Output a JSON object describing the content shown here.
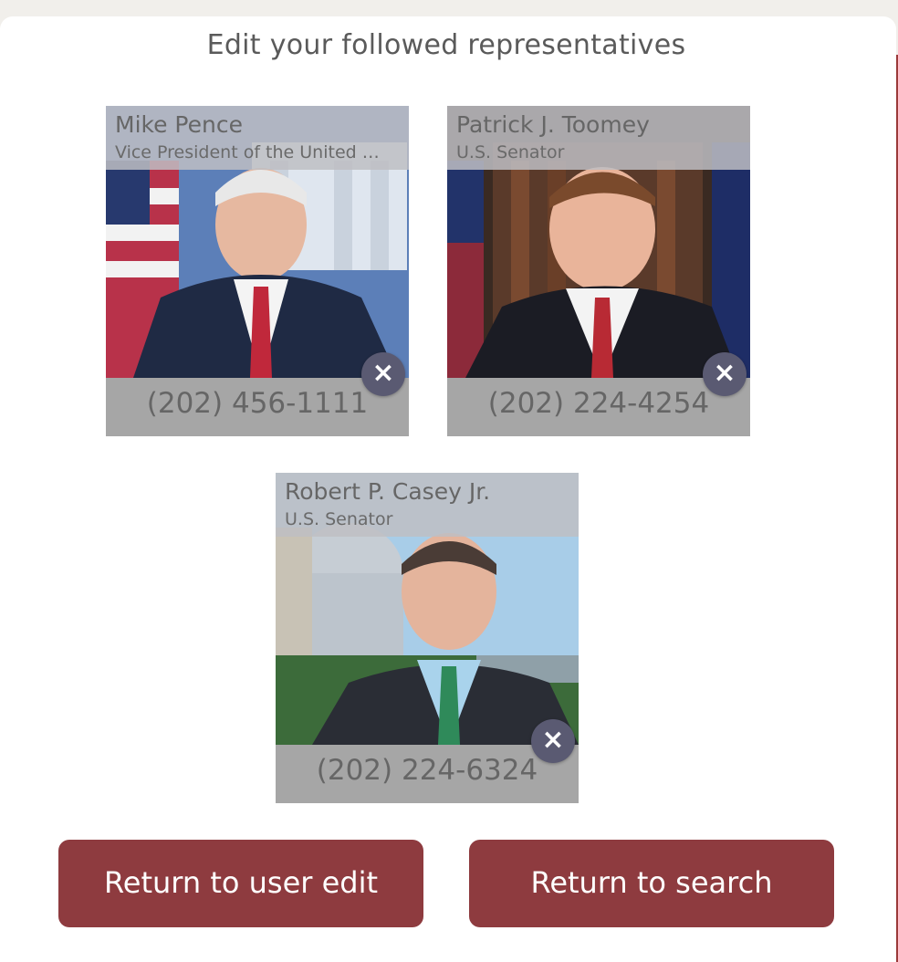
{
  "page": {
    "title": "Edit your followed representatives",
    "accent_color": "#8e3b3f"
  },
  "representatives": [
    {
      "name": "Mike Pence",
      "title": "Vice President of the United …",
      "phone": "(202) 456-1111",
      "remove_icon": "×"
    },
    {
      "name": "Patrick J. Toomey",
      "title": "U.S. Senator",
      "phone": "(202) 224-4254",
      "remove_icon": "×"
    },
    {
      "name": "Robert P. Casey Jr.",
      "title": "U.S. Senator",
      "phone": "(202) 224-6324",
      "remove_icon": "×"
    }
  ],
  "actions": {
    "return_user_edit": "Return to user edit",
    "return_search": "Return to search"
  }
}
